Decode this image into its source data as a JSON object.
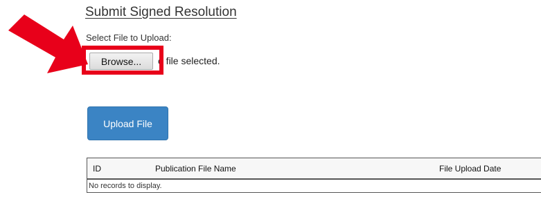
{
  "section": {
    "title": "Submit Signed Resolution",
    "select_label": "Select File to Upload:"
  },
  "file_input": {
    "browse_label": "Browse...",
    "status_text": "o file selected."
  },
  "upload": {
    "button_label": "Upload File"
  },
  "grid": {
    "columns": [
      "ID",
      "Publication File Name",
      "File Upload Date"
    ],
    "empty_message": "No records to display."
  },
  "colors": {
    "annotation_red": "#e8001a",
    "upload_button_blue": "#3b84c4"
  },
  "icons": {
    "annotation": "red-arrow-icon"
  }
}
